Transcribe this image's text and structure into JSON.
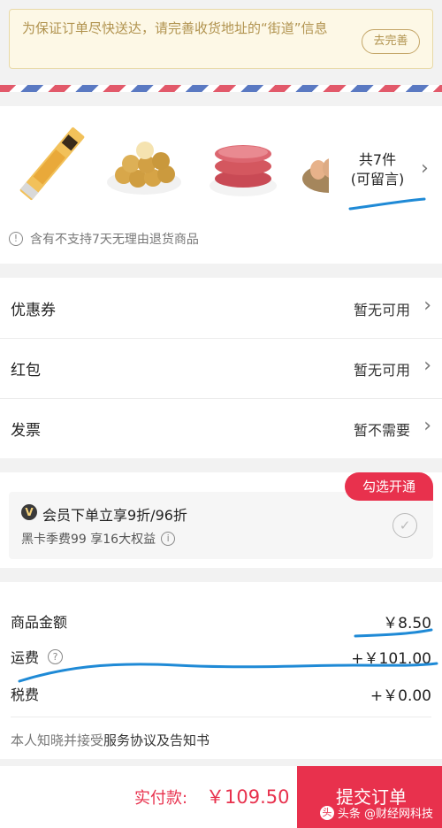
{
  "notice": {
    "text": "为保证订单尽快送达，请完善收货地址的“街道”信息",
    "button": "去完善"
  },
  "products": {
    "items": [
      {
        "icon": "snack-stick-icon"
      },
      {
        "icon": "potato-balls-icon"
      },
      {
        "icon": "beef-patty-icon"
      },
      {
        "icon": "eggs-icon"
      }
    ],
    "count": "共7件",
    "note": "(可留言)",
    "refund_notice": "含有不支持7天无理由退货商品"
  },
  "options": [
    {
      "label": "优惠券",
      "value": "暂无可用"
    },
    {
      "label": "红包",
      "value": "暂无可用"
    },
    {
      "label": "发票",
      "value": "暂不需要"
    }
  ],
  "member": {
    "badge": "V",
    "title": "会员下单立享9折/96折",
    "subtitle": "黑卡季费99 享16大权益",
    "tag": "勾选开通"
  },
  "fees": [
    {
      "label": "商品金额",
      "value": "￥8.50"
    },
    {
      "label": "运费",
      "value": "+￥101.00"
    },
    {
      "label": "税费",
      "value": "+￥0.00"
    }
  ],
  "agreement": {
    "prefix": "本人知晓并接受",
    "link": "服务协议及告知书"
  },
  "bottom": {
    "pay_label": "实付款:",
    "pay_value": "￥109.50",
    "submit": "提交订单"
  },
  "watermark": {
    "logo": "头",
    "text": "头条 @财经网科技"
  },
  "colors": {
    "accent": "#e8314d",
    "notice_text": "#b1934f",
    "annotation": "#1f8ad6"
  }
}
